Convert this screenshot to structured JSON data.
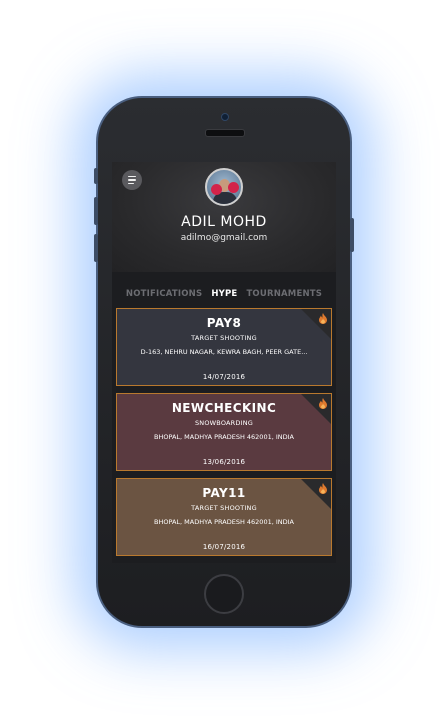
{
  "profile": {
    "name": "ADIL MOHD",
    "email": "adilmo@gmail.com"
  },
  "tabs": [
    {
      "label": "NOTIFICATIONS",
      "active": false
    },
    {
      "label": "HYPE",
      "active": true
    },
    {
      "label": "TOURNAMENTS",
      "active": false
    }
  ],
  "cards": [
    {
      "title": "PAY8",
      "sport": "TARGET SHOOTING",
      "address": "D-163, NEHRU NAGAR, KEWRA BAGH, PEER GATE...",
      "date": "14/07/2016",
      "color": "#34363f"
    },
    {
      "title": "NEWCHECKINC",
      "sport": "SNOWBOARDING",
      "address": "BHOPAL, MADHYA PRADESH 462001, INDIA",
      "date": "13/06/2016",
      "color": "#5a3a40"
    },
    {
      "title": "PAY11",
      "sport": "TARGET SHOOTING",
      "address": "BHOPAL, MADHYA PRADESH 462001, INDIA",
      "date": "16/07/2016",
      "color": "#6b5442"
    }
  ],
  "colors": {
    "accent": "#b9792e",
    "glow": "#6eaaff"
  },
  "icons": {
    "menu": "hamburger-icon",
    "hype": "fire-icon"
  }
}
